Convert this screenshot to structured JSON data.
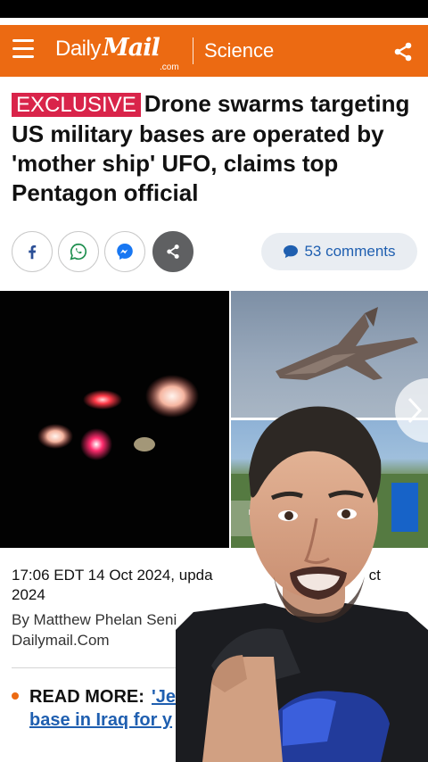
{
  "header": {
    "brand_daily": "Daily",
    "brand_mail": "Mail",
    "brand_com": ".com",
    "section": "Science",
    "accent_color": "#ec6a12"
  },
  "article": {
    "exclusive_label": "EXCLUSIVE",
    "headline": "Drone swarms targeting US military bases are operated by 'mother ship' UFO, claims top Pentagon official",
    "social": {
      "icons": [
        "facebook-icon",
        "whatsapp-icon",
        "messenger-icon",
        "share-icon"
      ],
      "comments_label": "53 comments"
    },
    "timestamp_line1": "17:06 EDT 14 Oct 2024, upda",
    "timestamp_line1_tail": "ct",
    "timestamp_line2": "2024",
    "byline_line1": "By Matthew Phelan Seni",
    "byline_line2": "Dailymail.Com",
    "read_more_label": "READ MORE:",
    "read_more_link_line1": "'Jel",
    "read_more_link_line2": "base in Iraq for y"
  },
  "gallery": {
    "images": [
      "night-sky-lights",
      "fighter-jet",
      "military-base-aerial"
    ]
  }
}
